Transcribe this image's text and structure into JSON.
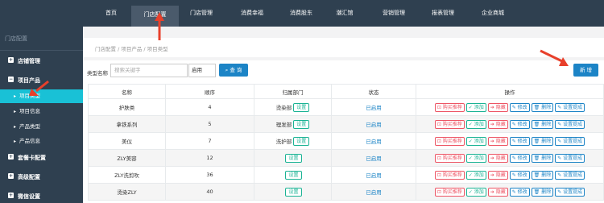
{
  "topnav": {
    "items": [
      "首页",
      "门店配置",
      "门店管理",
      "消费幸福",
      "消费股东",
      "潮汇馆",
      "营销管理",
      "报表管理",
      "企业商城"
    ],
    "active_index": 1
  },
  "sidebar": {
    "title": "门店配置",
    "groups": [
      {
        "label": "店铺管理",
        "icon": "plus-square-icon",
        "sign": "+"
      },
      {
        "label": "项目产品",
        "icon": "minus-square-icon",
        "sign": "−"
      },
      {
        "label": "套餐卡配置",
        "icon": "plus-square-icon",
        "sign": "+"
      },
      {
        "label": "高级配置",
        "icon": "plus-square-icon",
        "sign": "+"
      },
      {
        "label": "微信设置",
        "icon": "plus-square-icon",
        "sign": "+"
      }
    ],
    "subitems": [
      {
        "label": "项目类型",
        "active": true
      },
      {
        "label": "项目信息",
        "active": false
      },
      {
        "label": "产品类型",
        "active": false
      },
      {
        "label": "产品信息",
        "active": false
      }
    ]
  },
  "breadcrumb": "门店配置 / 项目产品 / 项目类型",
  "filter": {
    "label": "类型名称",
    "search_placeholder": "搜索关键字",
    "status_value": "启用",
    "query_label": "查 询",
    "query_icon": "search-icon",
    "add_label": "新 增"
  },
  "table": {
    "headers": [
      "名称",
      "顺序",
      "归属部门",
      "状态",
      "操作"
    ],
    "rows": [
      {
        "name": "护肤类",
        "order": "4",
        "dept": "烫染部",
        "status": "已启用"
      },
      {
        "name": "拿铁系列",
        "order": "5",
        "dept": "理发部",
        "status": "已启用"
      },
      {
        "name": "美仪",
        "order": "7",
        "dept": "洗护部",
        "status": "已启用"
      },
      {
        "name": "ZLY美容",
        "order": "12",
        "dept": "",
        "status": "已启用"
      },
      {
        "name": "ZLY洗剪吹",
        "order": "36",
        "dept": "",
        "status": "已启用"
      },
      {
        "name": "烫染ZLY",
        "order": "40",
        "dept": "",
        "status": "已启用"
      }
    ],
    "set_label": "设置",
    "actions": [
      "购买推荐",
      "添加",
      "隐藏",
      "修改",
      "删除",
      "设置提成"
    ],
    "action_icons": [
      "cart-icon",
      "check-icon",
      "arrow-icon",
      "edit-icon",
      "trash-icon",
      "edit-icon"
    ]
  },
  "colors": {
    "topbar": "#2f4050",
    "active_sub": "#19c1d6",
    "primary": "#1c84c6",
    "green": "#1ab394",
    "red": "#ed5565",
    "arrow": "#e8402b"
  }
}
